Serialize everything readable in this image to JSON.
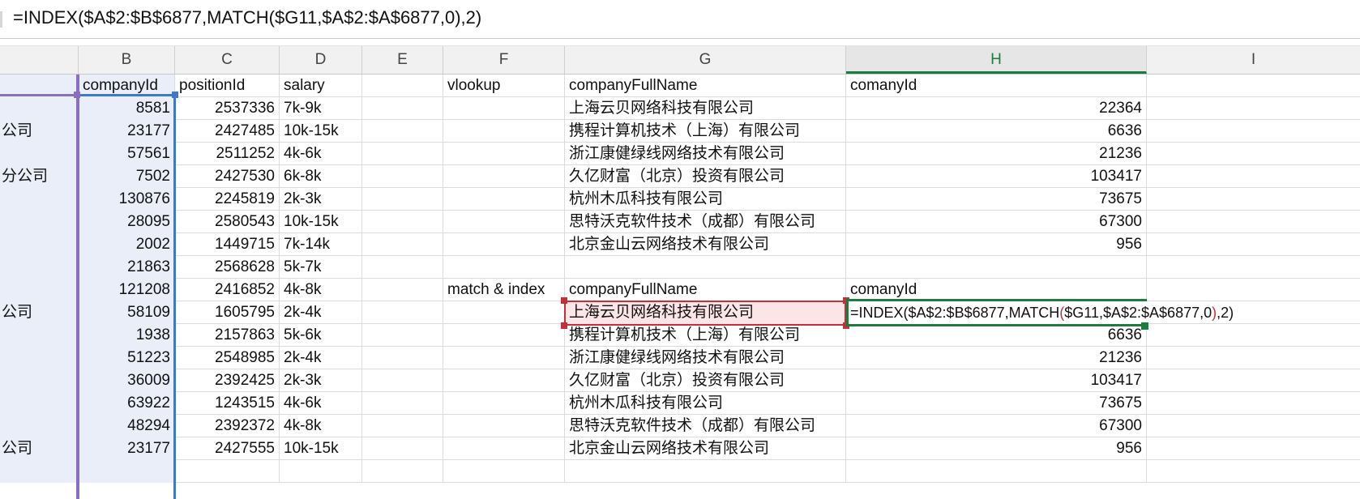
{
  "formula_bar": {
    "text": "=INDEX($A$2:$B$6877,MATCH($G11,$A$2:$A$6877,0),2)"
  },
  "columns": [
    "",
    "B",
    "C",
    "D",
    "E",
    "F",
    "G",
    "H",
    "I"
  ],
  "active_column": "H",
  "rows": [
    {
      "a": "",
      "b": "companyId",
      "c": "positionId",
      "d": "salary",
      "f": "vlookup",
      "g": "companyFullName",
      "h": "comanyId"
    },
    {
      "a": "",
      "b": "8581",
      "c": "2537336",
      "d": "7k-9k",
      "f": "",
      "g": "上海云贝网络科技有限公司",
      "h": "22364"
    },
    {
      "a": "公司",
      "b": "23177",
      "c": "2427485",
      "d": "10k-15k",
      "f": "",
      "g": "携程计算机技术（上海）有限公司",
      "h": "6636"
    },
    {
      "a": "",
      "b": "57561",
      "c": "2511252",
      "d": "4k-6k",
      "f": "",
      "g": "浙江康健绿线网络技术有限公司",
      "h": "21236"
    },
    {
      "a": "分公司",
      "b": "7502",
      "c": "2427530",
      "d": "6k-8k",
      "f": "",
      "g": "久亿财富（北京）投资有限公司",
      "h": "103417"
    },
    {
      "a": "",
      "b": "130876",
      "c": "2245819",
      "d": "2k-3k",
      "f": "",
      "g": "杭州木瓜科技有限公司",
      "h": "73675"
    },
    {
      "a": "",
      "b": "28095",
      "c": "2580543",
      "d": "10k-15k",
      "f": "",
      "g": "思特沃克软件技术（成都）有限公司",
      "h": "67300"
    },
    {
      "a": "",
      "b": "2002",
      "c": "1449715",
      "d": "7k-14k",
      "f": "",
      "g": "北京金山云网络技术有限公司",
      "h": "956"
    },
    {
      "a": "",
      "b": "21863",
      "c": "2568628",
      "d": "5k-7k",
      "f": "",
      "g": "",
      "h": ""
    },
    {
      "a": "",
      "b": "121208",
      "c": "2416852",
      "d": "4k-8k",
      "f": "match & index",
      "g": "companyFullName",
      "h": "comanyId"
    },
    {
      "a": "公司",
      "b": "58109",
      "c": "1605795",
      "d": "2k-4k",
      "f": "",
      "g": "",
      "h": ""
    },
    {
      "a": "",
      "b": "1938",
      "c": "2157863",
      "d": "5k-6k",
      "f": "",
      "g": "携程计算机技术（上海）有限公司",
      "h": "6636"
    },
    {
      "a": "",
      "b": "51223",
      "c": "2548985",
      "d": "2k-4k",
      "f": "",
      "g": "浙江康健绿线网络技术有限公司",
      "h": "21236"
    },
    {
      "a": "",
      "b": "36009",
      "c": "2392425",
      "d": "2k-3k",
      "f": "",
      "g": "久亿财富（北京）投资有限公司",
      "h": "103417"
    },
    {
      "a": "",
      "b": "63922",
      "c": "1243515",
      "d": "4k-6k",
      "f": "",
      "g": "杭州木瓜科技有限公司",
      "h": "73675"
    },
    {
      "a": "",
      "b": "48294",
      "c": "2392372",
      "d": "4k-8k",
      "f": "",
      "g": "思特沃克软件技术（成都）有限公司",
      "h": "67300"
    },
    {
      "a": "公司",
      "b": "23177",
      "c": "2427555",
      "d": "10k-15k",
      "f": "",
      "g": "北京金山云网络技术有限公司",
      "h": "956"
    },
    {
      "a": "",
      "b": "",
      "c": "",
      "d": "",
      "f": "",
      "g": "",
      "h": ""
    }
  ],
  "editing": {
    "g11_value": "上海云贝网络科技有限公司",
    "h11_part1": "=INDEX($A$2:$B$6877,MATCH",
    "h11_paren_open": "(",
    "h11_part2": "$G11,$A$2:$A$6877,0",
    "h11_paren_close": ")",
    "h11_part3": ",2)"
  },
  "colors": {
    "selection_purple": "#8a6fbf",
    "selection_blue": "#3f78c9",
    "edit_red": "#c0313a",
    "active_green": "#1f7a3f"
  }
}
